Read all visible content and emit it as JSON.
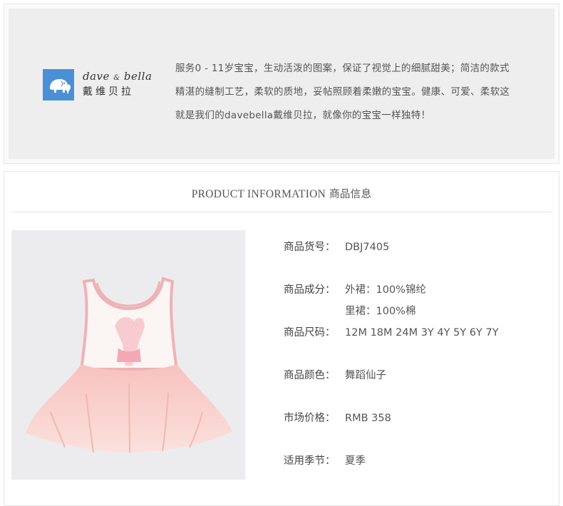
{
  "brand": {
    "logo_icon": "elephant-icon",
    "logo_color": "#4a90d6",
    "logo_en_left": "dave",
    "logo_en_amp": "&",
    "logo_en_right": "bella",
    "logo_cn": "戴维贝拉",
    "description_lines": [
      "服务0 - 11岁宝宝，生动活泼的图案，保证了视觉上的细腻甜美；简洁的款式",
      "精湛的缝制工艺，柔软的质地，妥帖照顾着柔嫩的宝宝。健康、可爱、柔软这",
      "就是我们的davebella戴维贝拉，就像你的宝宝一样独特！"
    ]
  },
  "product_info": {
    "title_en": "PRODUCT INFORMATION",
    "title_cn": "商品信息",
    "specs": [
      {
        "label": "商品货号：",
        "value": "DBJ7405"
      },
      {
        "label": "商品成分：",
        "value": "外裙：100%锦纶"
      },
      {
        "label": "",
        "value": "里裙：100%棉"
      },
      {
        "label": "商品尺码：",
        "value": "12M 18M 24M 3Y 4Y 5Y 6Y 7Y"
      },
      {
        "label": "商品颜色：",
        "value": "舞蹈仙子"
      },
      {
        "label": "市场价格：",
        "value": "RMB 358"
      },
      {
        "label": "适用季节：",
        "value": "夏季"
      }
    ]
  }
}
